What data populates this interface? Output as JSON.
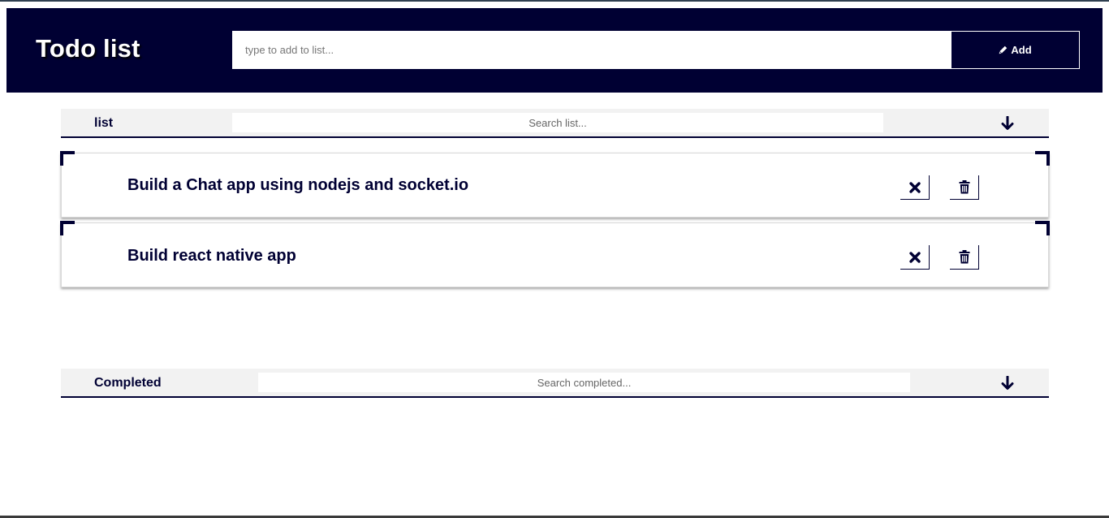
{
  "header": {
    "title": "Todo list",
    "add_placeholder": "type to add to list...",
    "add_button_label": "Add",
    "add_button_icon": "pencil-icon"
  },
  "list_section": {
    "title": "list",
    "search_placeholder": "Search list...",
    "toggle_icon": "arrow-down-icon",
    "items": [
      {
        "text": "Build a Chat app using nodejs and socket.io",
        "complete_icon": "close-icon",
        "delete_icon": "trash-icon"
      },
      {
        "text": "Build react native app",
        "complete_icon": "close-icon",
        "delete_icon": "trash-icon"
      }
    ]
  },
  "completed_section": {
    "title": "Completed",
    "search_placeholder": "Search completed...",
    "toggle_icon": "arrow-down-icon",
    "items": []
  },
  "colors": {
    "primary": "#000033",
    "bar_background": "#f2f2f2",
    "white": "#ffffff"
  }
}
